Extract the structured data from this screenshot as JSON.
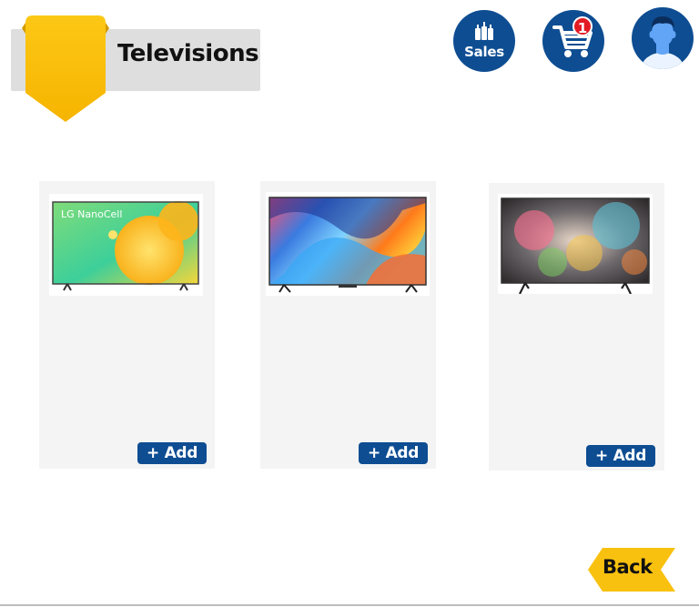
{
  "header": {
    "title": "Televisions"
  },
  "top_nav": {
    "sales_label": "Sales",
    "cart_count": "1"
  },
  "products": [
    {
      "image_text": "LG NanoCell",
      "add_label": "+ Add"
    },
    {
      "image_text": "",
      "add_label": "+ Add"
    },
    {
      "image_text": "",
      "add_label": "+ Add"
    }
  ],
  "footer": {
    "back_label": "Back"
  },
  "colors": {
    "accent_blue": "#0e4d92",
    "ribbon_yellow": "#f9c10f",
    "badge_red": "#e31b23",
    "card_bg": "#f4f4f4"
  }
}
